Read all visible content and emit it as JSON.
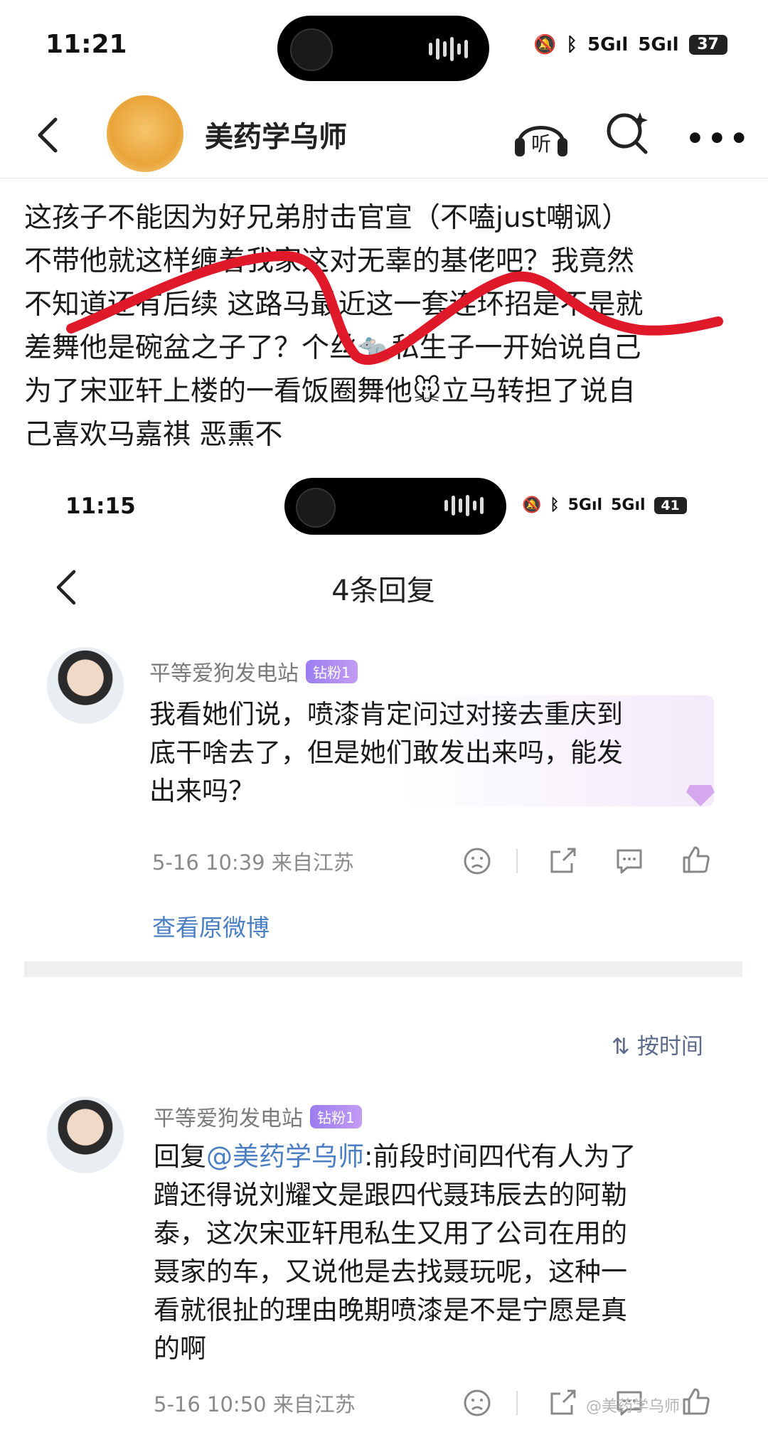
{
  "status_bar": {
    "time": "11:21",
    "signal1": "5G",
    "signal2": "5G",
    "battery": "37"
  },
  "header": {
    "title": "美药学乌师",
    "listen_label": "听",
    "more": "•••"
  },
  "post": {
    "lines": [
      "这孩子不能因为好兄弟肘击官宣（不嗑just嘲讽）",
      "不带他就这样缠着我家这对无辜的基佬吧？我竟然",
      "不知道还有后续 这路马最近这一套连环招是不是就",
      "差舞他是碗盆之子了？个丝🐀私生子一开始说自己",
      "为了宋亚轩上楼的一看饭圈舞他🐭立马转担了说自",
      "己喜欢马嘉祺 恶熏不"
    ]
  },
  "inner": {
    "status_bar": {
      "time": "11:15",
      "signal1": "5G",
      "signal2": "5G",
      "battery": "41"
    },
    "title": "4条回复",
    "comment1": {
      "username": "平等爱狗发电站",
      "badge": "钻粉1",
      "lines": [
        "我看她们说，喷漆肯定问过对接去重庆到",
        "底干啥去了，但是她们敢发出来吗，能发",
        "出来吗？"
      ],
      "meta": "5-16 10:39 来自江苏"
    },
    "view_original": "查看原微博",
    "sort_label": "按时间",
    "comment2": {
      "username": "平等爱狗发电站",
      "badge": "钻粉1",
      "reply_prefix": "回复",
      "mention": "@美药学乌师",
      "first_line_rest": ":前段时间四代有人为了",
      "lines": [
        "蹭还得说刘耀文是跟四代聂玮辰去的阿勒",
        "泰，这次宋亚轩甩私生又用了公司在用的",
        "聂家的车，又说他是去找聂玩呢，这种一",
        "看就很扯的理由晚期喷漆是不是宁愿是真",
        "的啊"
      ],
      "meta": "5-16 10:50 来自江苏"
    },
    "watermark": "@美药学乌师"
  }
}
